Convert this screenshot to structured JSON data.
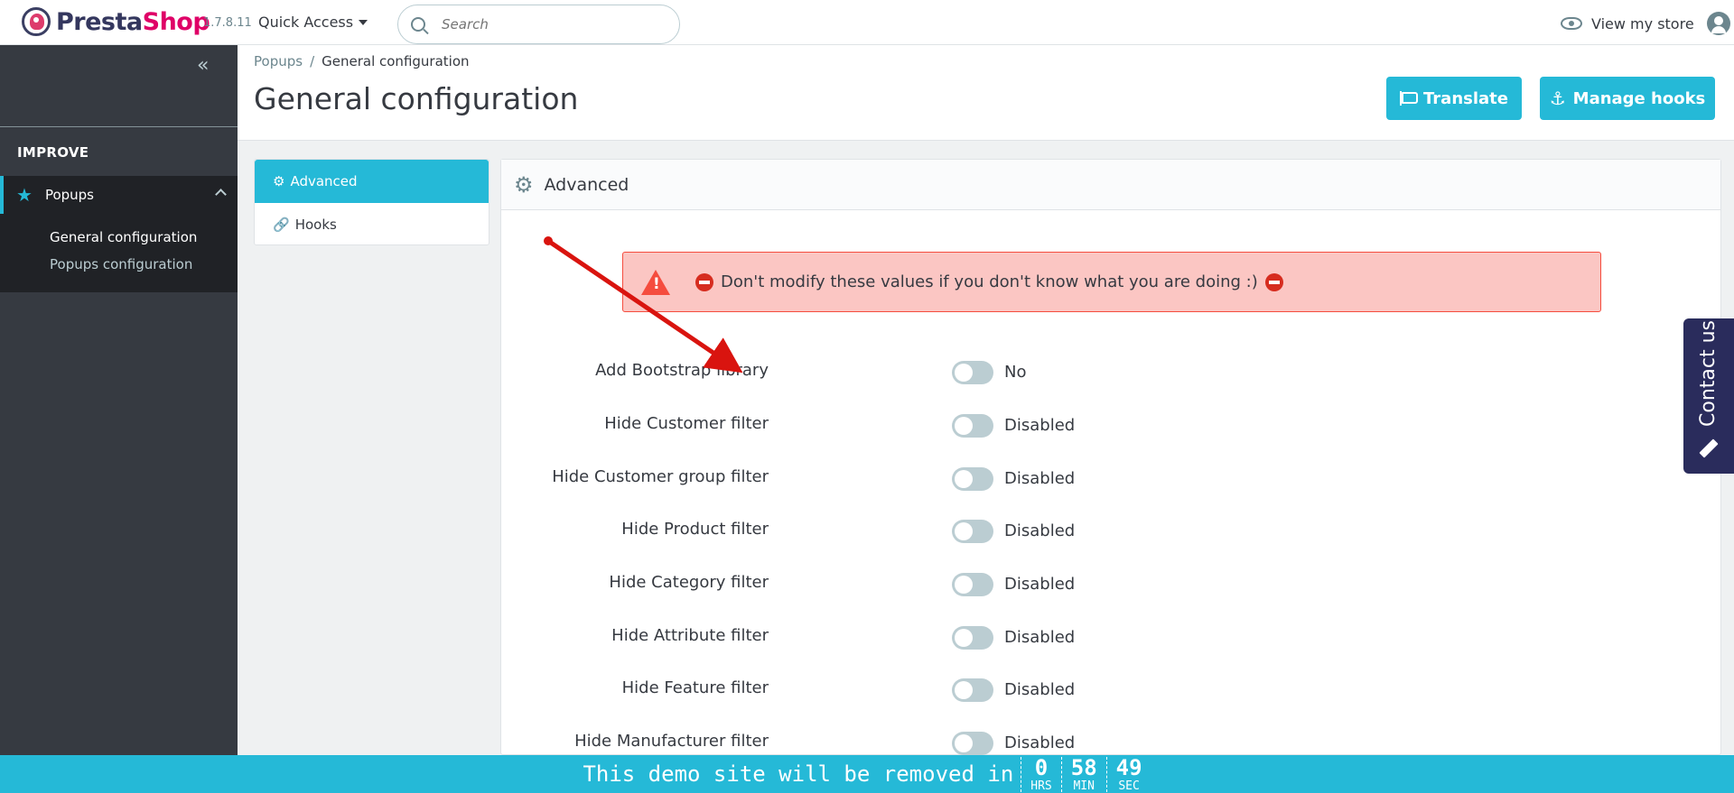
{
  "header": {
    "brand_part1": "Presta",
    "brand_part2": "Shop",
    "version": "1.7.8.11",
    "quick_access": "Quick Access",
    "search_placeholder": "Search",
    "view_store": "View my store"
  },
  "sidebar": {
    "section_title": "IMPROVE",
    "menu_item": "Popups",
    "submenu": [
      "General configuration",
      "Popups configuration"
    ]
  },
  "page": {
    "breadcrumb": [
      "Popups",
      "General configuration"
    ],
    "breadcrumb_sep": "/",
    "title": "General configuration",
    "translate_button": "Translate",
    "manage_hooks_button": "Manage hooks"
  },
  "tabs": [
    {
      "label": "Advanced",
      "active": true
    },
    {
      "label": "Hooks",
      "active": false
    }
  ],
  "panel": {
    "title": "Advanced",
    "alert": "Don't modify these values if you don't know what you are doing :)",
    "fields": [
      {
        "label": "Add Bootstrap library",
        "value": "No"
      },
      {
        "label": "Hide Customer filter",
        "value": "Disabled"
      },
      {
        "label": "Hide Customer group filter",
        "value": "Disabled"
      },
      {
        "label": "Hide Product filter",
        "value": "Disabled"
      },
      {
        "label": "Hide Category filter",
        "value": "Disabled"
      },
      {
        "label": "Hide Attribute filter",
        "value": "Disabled"
      },
      {
        "label": "Hide Feature filter",
        "value": "Disabled"
      },
      {
        "label": "Hide Manufacturer filter",
        "value": "Disabled"
      }
    ]
  },
  "contact": {
    "label": "Contact us"
  },
  "demo_bar": {
    "text": "This demo site will be removed in",
    "hours": "0",
    "hours_unit": "HRS",
    "minutes": "58",
    "minutes_unit": "MIN",
    "seconds": "49",
    "seconds_unit": "SEC"
  },
  "colors": {
    "accent": "#25b9d7",
    "sidebar": "#363a41",
    "alert_bg": "#fbc6c3",
    "alert_border": "#f54c3e",
    "annotation_arrow": "#d9140f"
  }
}
